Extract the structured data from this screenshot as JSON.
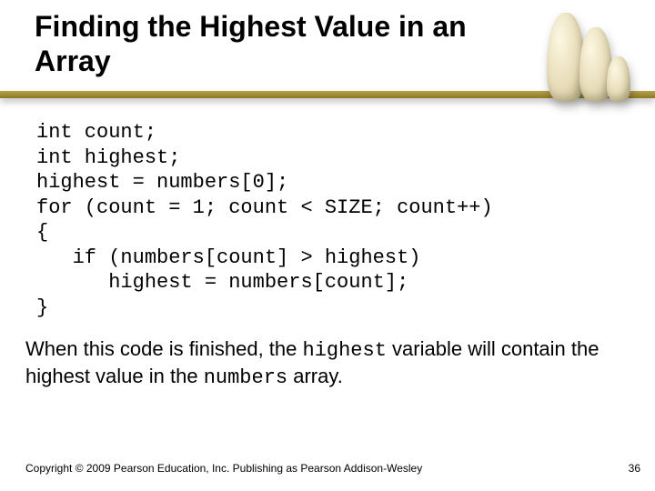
{
  "title": "Finding the Highest Value in an Array",
  "code": {
    "l1": "int count;",
    "l2": "int highest;",
    "l3": "highest = numbers[0];",
    "l4": "for (count = 1; count < SIZE; count++)",
    "l5": "{",
    "l6": "   if (numbers[count] > highest)",
    "l7": "      highest = numbers[count];",
    "l8": "}"
  },
  "explain": {
    "part1": "When this code is finished, the ",
    "mono1": "highest",
    "part2": " variable will contain the highest value in the ",
    "mono2": "numbers",
    "part3": " array."
  },
  "footer": {
    "copyright": "Copyright © 2009 Pearson Education, Inc. Publishing as Pearson Addison-Wesley",
    "page": "36"
  },
  "decor": {
    "image_alt": "chess pieces"
  }
}
